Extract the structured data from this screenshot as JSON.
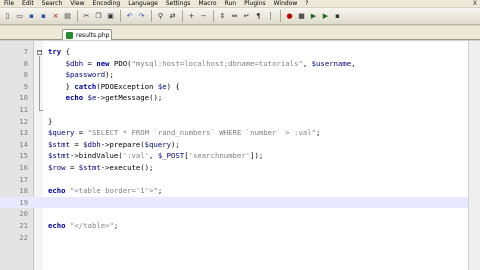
{
  "menubar": {
    "items": [
      "File",
      "Edit",
      "Search",
      "View",
      "Encoding",
      "Language",
      "Settings",
      "Macro",
      "Run",
      "Plugins",
      "Window",
      "?"
    ],
    "close_label": "X"
  },
  "toolbar": {
    "groups": [
      [
        "new-file-icon",
        "open-folder-icon",
        "save-icon",
        "save-all-icon",
        "close-file-icon",
        "print-icon"
      ],
      [
        "cut-icon",
        "copy-icon",
        "paste-icon"
      ],
      [
        "undo-icon",
        "redo-icon"
      ],
      [
        "find-icon",
        "replace-icon"
      ],
      [
        "zoom-in-icon",
        "zoom-out-icon"
      ],
      [
        "sync-vertical-icon",
        "sync-horizontal-icon",
        "word-wrap-icon",
        "show-all-chars-icon",
        "indent-guide-icon"
      ],
      [
        "record-macro-icon",
        "stop-macro-icon",
        "play-macro-icon",
        "run-macro-multiple-icon",
        "save-macro-icon"
      ]
    ]
  },
  "tabs": [
    {
      "label": "results.php",
      "icon": "php-file-icon",
      "active": true
    }
  ],
  "editor": {
    "lines": [
      {
        "n": "7",
        "text": "try {"
      },
      {
        "n": "8",
        "text": "    $dbh = new PDO(\"mysql:host=localhost;dbname=tutorials\", $username,"
      },
      {
        "n": "8",
        "text": "    $password);"
      },
      {
        "n": "9",
        "text": "    } catch(PDOException $e) {"
      },
      {
        "n": "10",
        "text": "    echo $e->getMessage();"
      },
      {
        "n": "11",
        "text": ""
      },
      {
        "n": "12",
        "text": "}"
      },
      {
        "n": "13",
        "text": "$query = \"SELECT * FROM `rand_numbers` WHERE `number` > :val\";"
      },
      {
        "n": "14",
        "text": "$stmt = $dbh->prepare($query);"
      },
      {
        "n": "15",
        "text": "$stmt->bindValue(':val', $_POST['searchnumber']);"
      },
      {
        "n": "16",
        "text": "$row = $stmt->execute();"
      },
      {
        "n": "17",
        "text": ""
      },
      {
        "n": "18",
        "text": "echo \"<table border='1'>\";"
      },
      {
        "n": "19",
        "text": ""
      },
      {
        "n": "20",
        "text": ""
      },
      {
        "n": "21",
        "text": "echo \"</table>\";"
      },
      {
        "n": "22",
        "text": ""
      }
    ],
    "current_line_index": 13
  }
}
